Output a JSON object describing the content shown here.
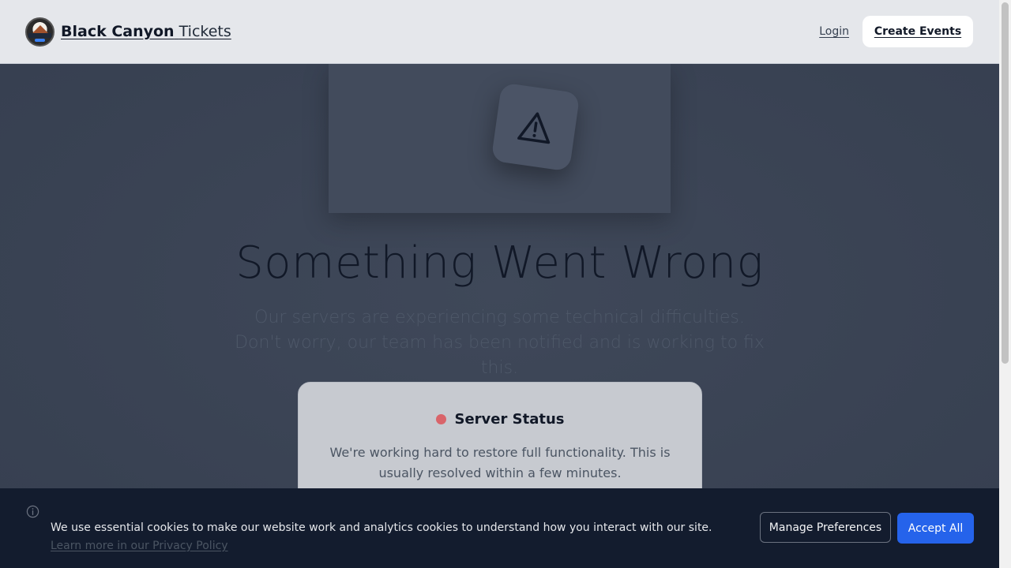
{
  "header": {
    "brand_bold": "Black Canyon",
    "brand_light": "Tickets",
    "login_label": "Login",
    "create_events_label": "Create Events"
  },
  "main": {
    "title": "Something Went Wrong",
    "subtitle": "Our servers are experiencing some technical difficulties. Don't worry, our team has been notified and is working to fix this.",
    "status_card": {
      "title": "Server Status",
      "text": "We're working hard to restore full functionality. This is usually resolved within a few minutes.",
      "indicator_color": "#d9646a"
    }
  },
  "cookie_banner": {
    "text": "We use essential cookies to make our website work and analytics cookies to understand how you interact with our site.",
    "link_text": "Learn more in our Privacy Policy",
    "manage_label": "Manage Preferences",
    "accept_label": "Accept All"
  },
  "icons": {
    "logo": "black-canyon-logo",
    "warning": "warning-triangle-icon",
    "info": "info-icon"
  },
  "colors": {
    "accent": "#2563eb",
    "status_error": "#d9646a",
    "banner_bg": "#131c2e"
  }
}
